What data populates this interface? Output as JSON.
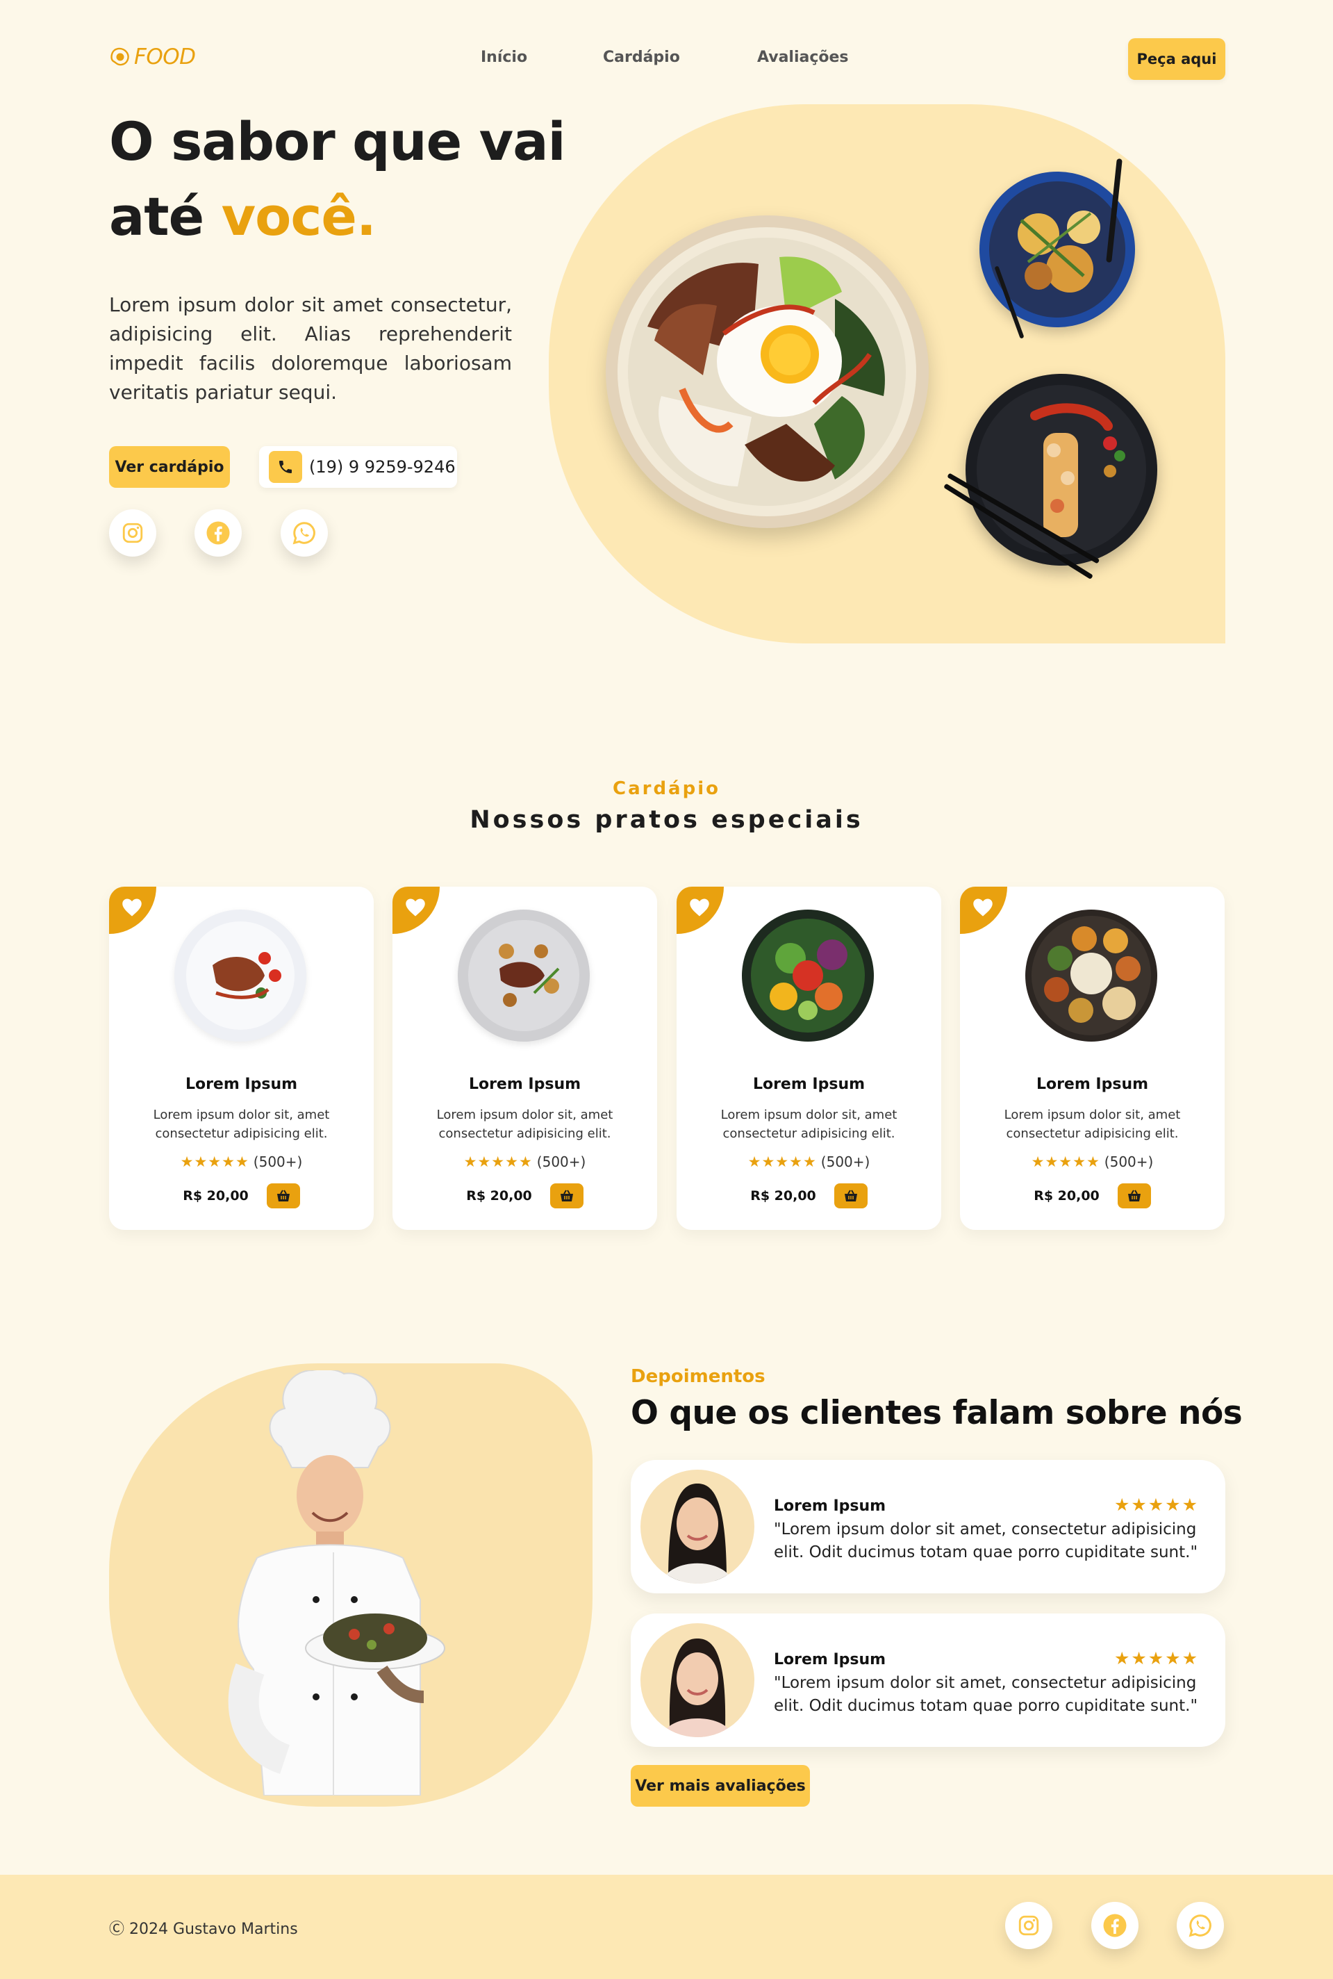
{
  "brand": {
    "logo_text": "FOOD",
    "accent_color": "#e9a10f",
    "button_color": "#fcc94b"
  },
  "nav": {
    "items": [
      "Início",
      "Cardápio",
      "Avaliações"
    ],
    "order_button": "Peça aqui"
  },
  "hero": {
    "title_line1": "O sabor que vai",
    "title_line2_prefix": "até ",
    "title_line2_accent": "você.",
    "description": "Lorem ipsum dolor sit amet consectetur, adipisicing elit. Alias reprehenderit impedit facilis doloremque laboriosam veritatis pariatur sequi.",
    "menu_button": "Ver cardápio",
    "phone": "(19) 9 9259-9246",
    "socials": [
      "instagram-icon",
      "facebook-icon",
      "whatsapp-icon"
    ]
  },
  "menu_section": {
    "subtitle": "Cardápio",
    "title": "Nossos pratos especiais",
    "cards": [
      {
        "title": "Lorem Ipsum",
        "description": "Lorem ipsum dolor sit, amet consectetur adipisicing elit.",
        "stars": "★★★★★",
        "rating_count": "(500+)",
        "price": "R$ 20,00",
        "rating": 5
      },
      {
        "title": "Lorem Ipsum",
        "description": "Lorem ipsum dolor sit, amet consectetur adipisicing elit.",
        "stars": "★★★★★",
        "rating_count": "(500+)",
        "price": "R$ 20,00",
        "rating": 5
      },
      {
        "title": "Lorem Ipsum",
        "description": "Lorem ipsum dolor sit, amet consectetur adipisicing elit.",
        "stars": "★★★★★",
        "rating_count": "(500+)",
        "price": "R$ 20,00",
        "rating": 5
      },
      {
        "title": "Lorem Ipsum",
        "description": "Lorem ipsum dolor sit, amet consectetur adipisicing elit.",
        "stars": "★★★★★",
        "rating_count": "(500+)",
        "price": "R$ 20,00",
        "rating": 5
      }
    ]
  },
  "testimonials": {
    "subtitle": "Depoimentos",
    "title": "O que os clientes falam sobre nós",
    "reviews": [
      {
        "name": "Lorem Ipsum",
        "stars": "★★★★★",
        "text": "\"Lorem ipsum dolor sit amet, consectetur adipisicing elit. Odit ducimus totam quae porro cupiditate sunt.\"",
        "rating": 5
      },
      {
        "name": "Lorem Ipsum",
        "stars": "★★★★★",
        "text": "\"Lorem ipsum dolor sit amet, consectetur adipisicing elit. Odit ducimus totam quae porro cupiditate sunt.\"",
        "rating": 5
      }
    ],
    "more_button": "Ver mais avaliações"
  },
  "footer": {
    "copyright": "Ⓒ 2024 Gustavo Martins"
  }
}
